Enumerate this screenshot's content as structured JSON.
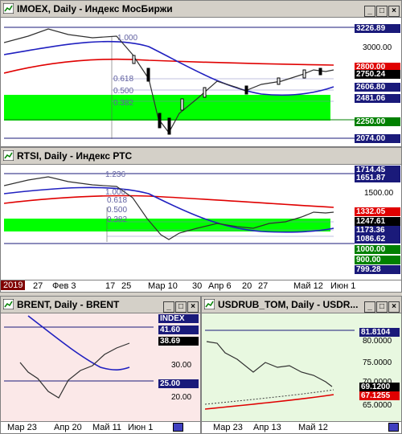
{
  "window_buttons": {
    "minimize": "_",
    "maximize": "□",
    "close": "×"
  },
  "imoex": {
    "title": "IMOEX, Daily - Индекс МосБиржи",
    "labels": [
      "3226.89",
      "3000.00",
      "2800.00",
      "2750.24",
      "2606.80",
      "2481.06",
      "2250.00",
      "2074.00"
    ],
    "fib": [
      "0.618",
      "0.500",
      "0.382"
    ],
    "fib_top": "1.000",
    "xticks": [
      "27",
      "Фев 3",
      "17",
      "25",
      "Мар 10",
      "30",
      "Апр 6",
      "20",
      "27",
      "Май 12",
      "Июн 1"
    ],
    "year_tag": "2019",
    "colors": {
      "green_zone": "#00ff00",
      "ma_red": "#e00000",
      "ma_blue": "#2020c0",
      "label_blue": "#1a1a7a",
      "label_black": "#000000"
    }
  },
  "rtsi": {
    "title": "RTSI, Daily - Индекс РТС",
    "labels": [
      "1714.45",
      "1651.87",
      "1500.00",
      "1332.05",
      "1247.61",
      "1173.36",
      "1086.62",
      "1000.00",
      "900.00",
      "799.28"
    ],
    "fib": [
      "0.618",
      "0.500",
      "0.382"
    ],
    "fib_top": "1.000",
    "fib_ext": "1.236"
  },
  "brent": {
    "title": "BRENT, Daily - BRENT",
    "index_tag": "INDEX",
    "labels": [
      "41.60",
      "38.69",
      "30.00",
      "25.00",
      "20.00"
    ],
    "xticks": [
      "Мар 23",
      "Апр 20",
      "Май 11",
      "Июн 1"
    ]
  },
  "usdrub": {
    "title": "USDRUB_TOM, Daily - USDR...",
    "labels": [
      "81.8104",
      "80.0000",
      "75.0000",
      "70.0000",
      "69.1200",
      "67.1255",
      "65.0000"
    ],
    "xticks": [
      "Мар 23",
      "Апр 13",
      "Май 12"
    ]
  }
}
